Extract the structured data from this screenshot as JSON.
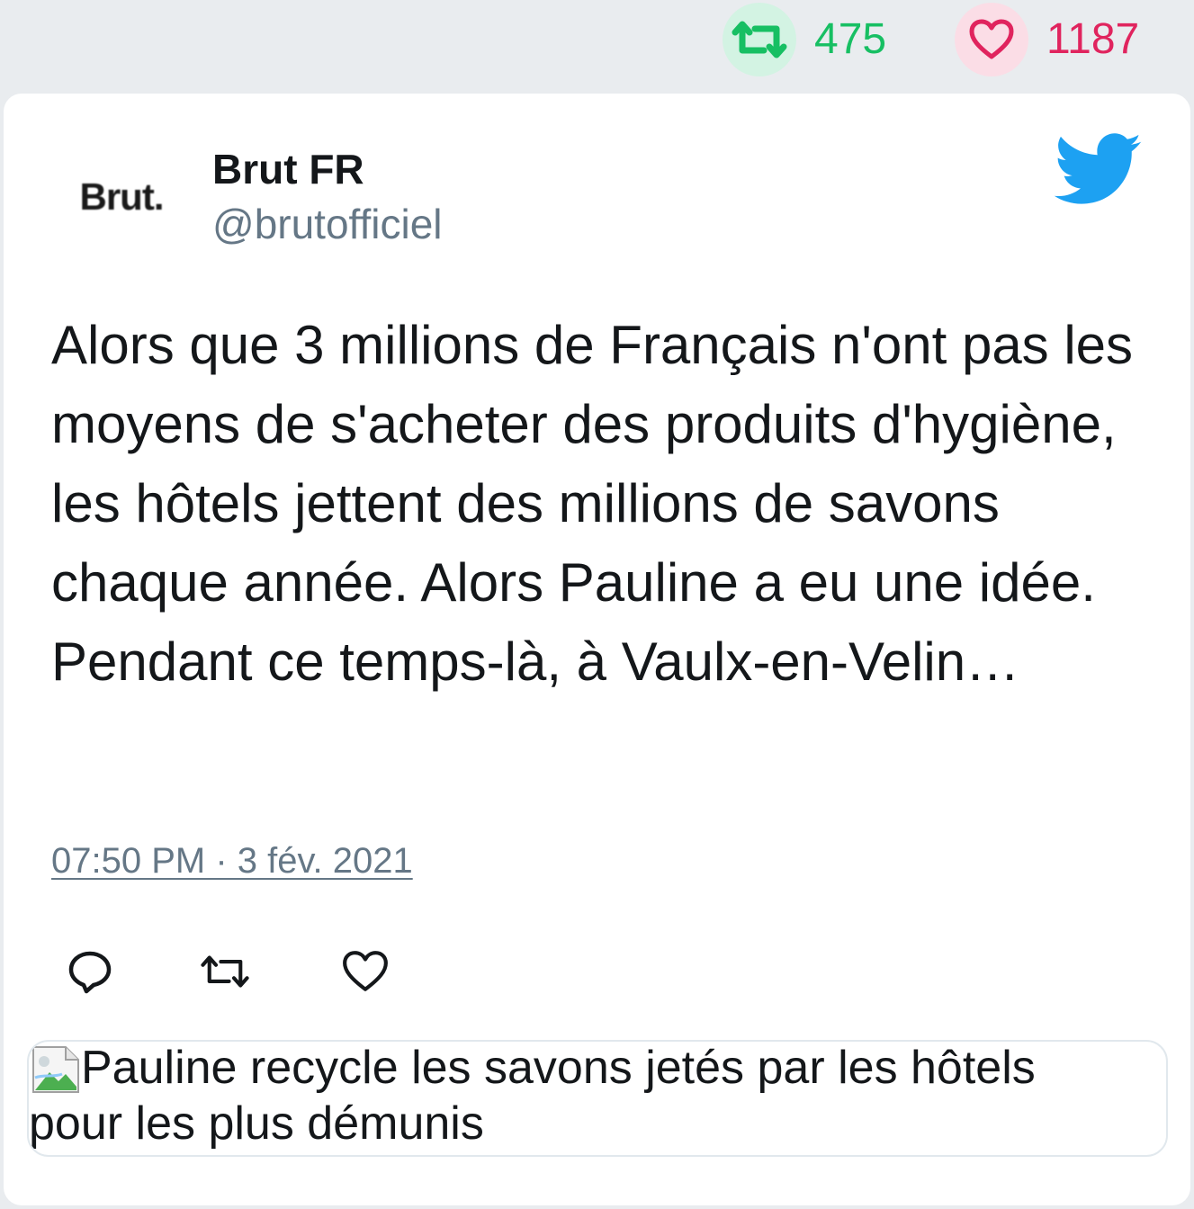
{
  "stats": {
    "retweets": "475",
    "likes": "1187",
    "retweet_color": "#17bf63",
    "like_color": "#e0245e"
  },
  "author": {
    "avatar_text": "Brut.",
    "name": "Brut FR",
    "handle": "@brutofficiel"
  },
  "tweet": {
    "text": "Alors que 3 millions de Français n'ont pas les moyens de s'acheter des produits d'hygiène, les hôtels jettent des millions de savons chaque année. Alors Pauline a eu une idée. Pendant ce temps-là, à Vaulx-en-Velin…",
    "timestamp": "07:50 PM · 3 fév. 2021"
  },
  "actions": {
    "reply_icon": "reply-icon",
    "retweet_icon": "retweet-icon",
    "like_icon": "heart-icon"
  },
  "link_card": {
    "alt_text": "Pauline recycle les savons jetés par les hôtels pour les plus démunis"
  },
  "brand": {
    "twitter_blue": "#1da1f2",
    "icon": "twitter-bird-icon"
  }
}
